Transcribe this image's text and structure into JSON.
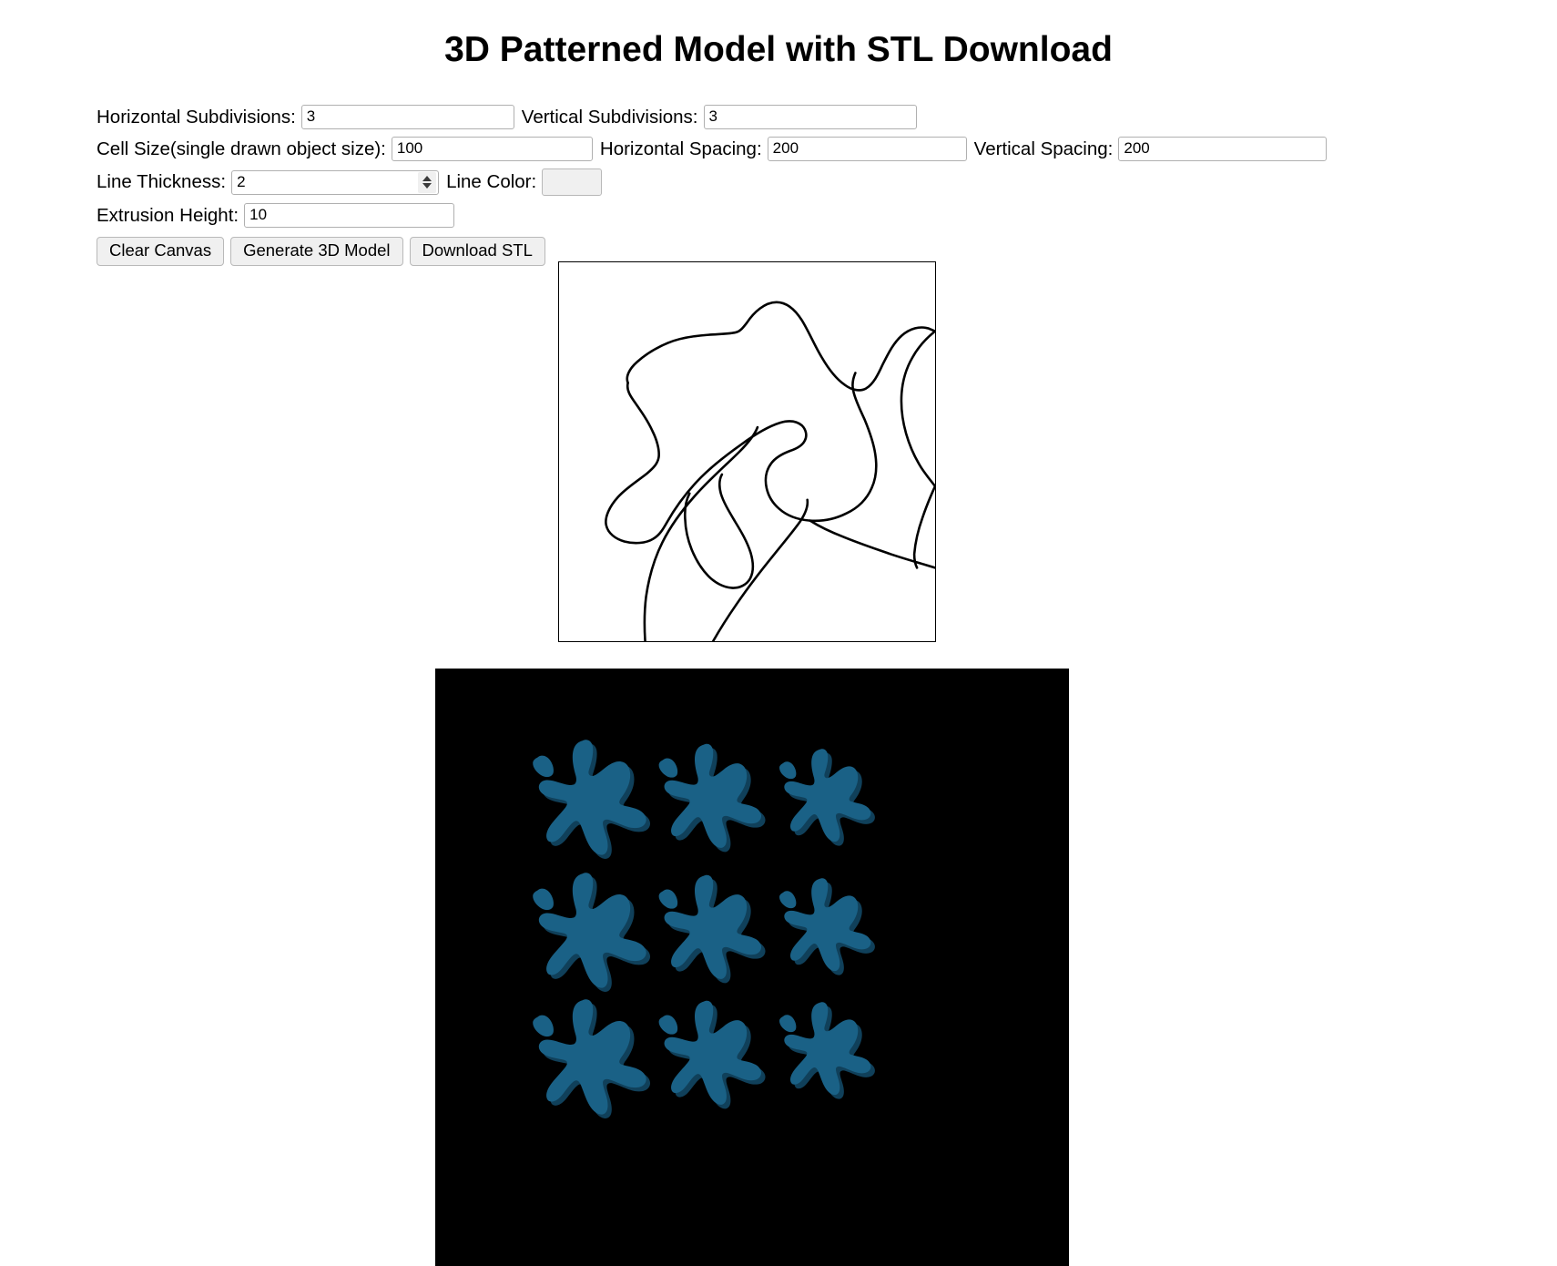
{
  "header": {
    "title": "3D Patterned Model with STL Download"
  },
  "controls": {
    "horizontal_subdivisions": {
      "label": "Horizontal Subdivisions:",
      "value": "3"
    },
    "vertical_subdivisions": {
      "label": "Vertical Subdivisions:",
      "value": "3"
    },
    "cell_size": {
      "label": "Cell Size(single drawn object size):",
      "value": "100"
    },
    "horizontal_spacing": {
      "label": "Horizontal Spacing:",
      "value": "200"
    },
    "vertical_spacing": {
      "label": "Vertical Spacing:",
      "value": "200"
    },
    "line_thickness": {
      "label": "Line Thickness:",
      "value": "2"
    },
    "line_color": {
      "label": "Line Color:",
      "value": "#000000"
    },
    "extrusion_height": {
      "label": "Extrusion Height:",
      "value": "10"
    }
  },
  "buttons": {
    "clear_canvas": "Clear Canvas",
    "generate_model": "Generate 3D Model",
    "download_stl": "Download STL"
  },
  "canvas": {
    "background": "#ffffff",
    "border_color": "#000000",
    "stroke_color": "#000000",
    "stroke_width": 2
  },
  "viewport": {
    "background": "#000000",
    "model_color": "#1a6186",
    "rows": 3,
    "columns": 3,
    "instances": 9
  }
}
